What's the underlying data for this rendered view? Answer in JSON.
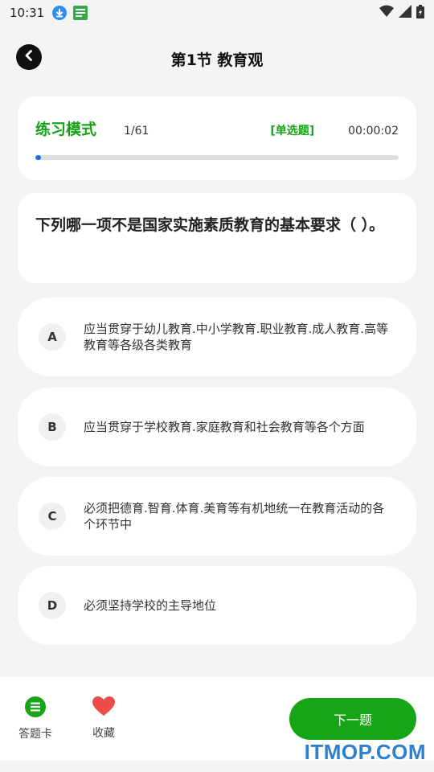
{
  "status_bar": {
    "time": "10:31",
    "icons": [
      "download-icon",
      "app-notification-icon",
      "wifi-icon",
      "signal-icon",
      "battery-icon"
    ]
  },
  "header": {
    "title": "第1节 教育观",
    "back_icon": "chevron-left-icon"
  },
  "practice": {
    "mode_label": "练习模式",
    "progress_text": "1/61",
    "progress_fraction": 0.0164,
    "question_type": "[单选题]",
    "timer": "00:00:02"
  },
  "question": {
    "text": "下列哪一项不是国家实施素质教育的基本要求（ ）。"
  },
  "options": [
    {
      "letter": "A",
      "text": "应当贯穿于幼儿教育.中小学教育.职业教育.成人教育.高等教育等各级各类教育"
    },
    {
      "letter": "B",
      "text": "应当贯穿于学校教育.家庭教育和社会教育等各个方面"
    },
    {
      "letter": "C",
      "text": "必须把德育.智育.体育.美育等有机地统一在教育活动的各个环节中"
    },
    {
      "letter": "D",
      "text": "必须坚持学校的主导地位"
    }
  ],
  "bottom_bar": {
    "answer_card_label": "答题卡",
    "favorite_label": "收藏",
    "next_label": "下一题"
  },
  "watermark": "ITMOP.COM",
  "colors": {
    "accent_green": "#16a516",
    "progress_blue": "#1d6fe0",
    "heart_red": "#ee4b4b",
    "watermark_blue": "#2f7fd0"
  }
}
